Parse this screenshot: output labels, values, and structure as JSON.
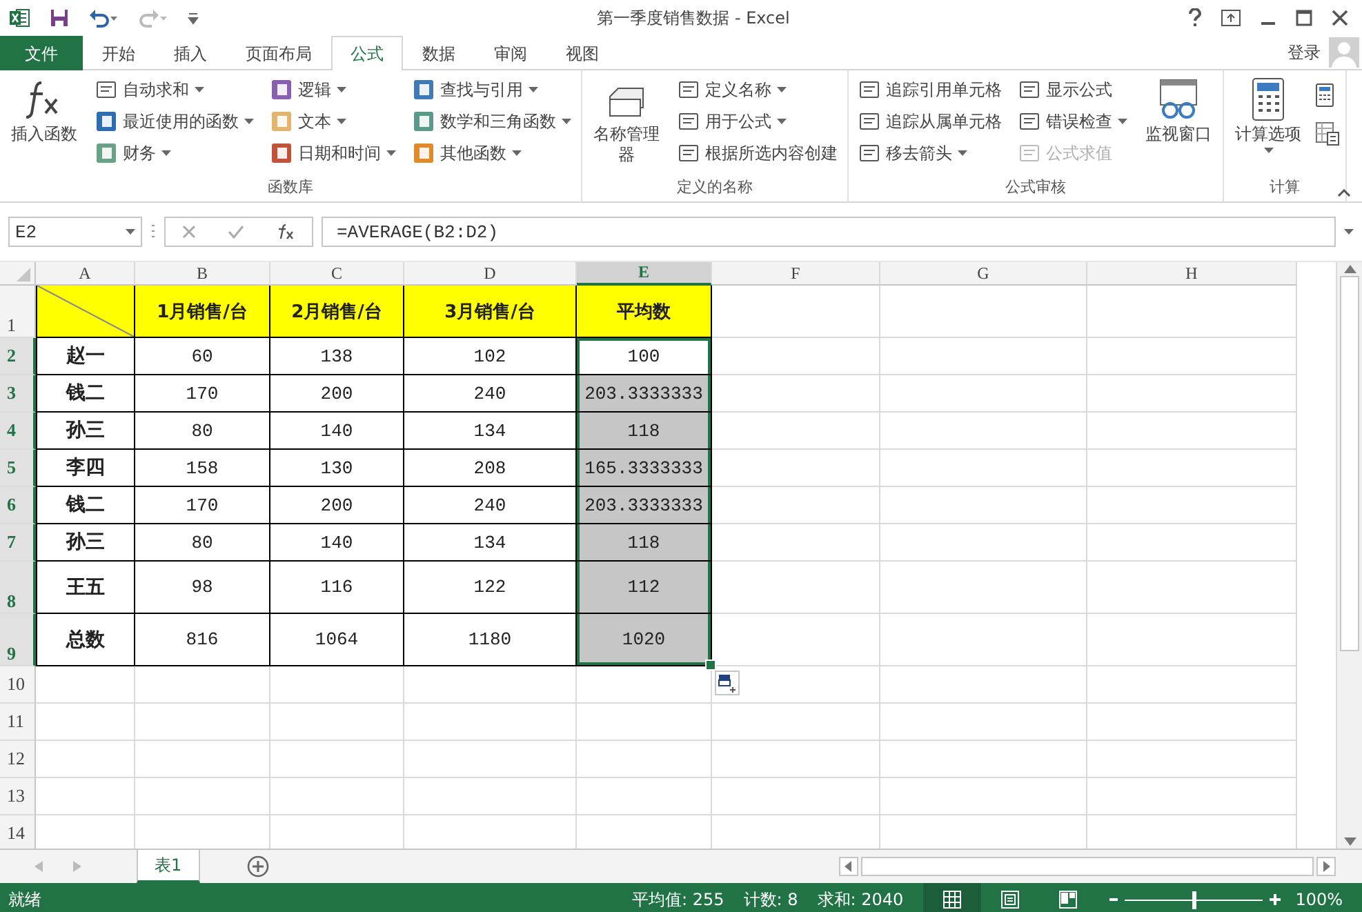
{
  "window": {
    "title": "第一季度销售数据 - Excel"
  },
  "account": {
    "label": "登录"
  },
  "tabs": [
    {
      "label": "文件",
      "kind": "file",
      "selected": false
    },
    {
      "label": "开始",
      "kind": "tab",
      "selected": false
    },
    {
      "label": "插入",
      "kind": "tab",
      "selected": false
    },
    {
      "label": "页面布局",
      "kind": "tab",
      "selected": false
    },
    {
      "label": "公式",
      "kind": "tab",
      "selected": true
    },
    {
      "label": "数据",
      "kind": "tab",
      "selected": false
    },
    {
      "label": "审阅",
      "kind": "tab",
      "selected": false
    },
    {
      "label": "视图",
      "kind": "tab",
      "selected": false
    }
  ],
  "ribbon": {
    "groups": [
      {
        "name": "函数库",
        "items": [
          {
            "kind": "large",
            "label": "插入函数",
            "dropdown": false
          },
          {
            "kind": "stack",
            "items": [
              {
                "label": "自动求和",
                "dropdown": true,
                "disabled": false
              },
              {
                "label": "最近使用的函数",
                "dropdown": true,
                "disabled": false,
                "color": "#2f6db3"
              },
              {
                "label": "财务",
                "dropdown": true,
                "disabled": false,
                "color": "#6aa287"
              }
            ]
          },
          {
            "kind": "stack",
            "items": [
              {
                "label": "逻辑",
                "dropdown": true,
                "disabled": false,
                "color": "#8a5fb0"
              },
              {
                "label": "文本",
                "dropdown": true,
                "disabled": false,
                "color": "#e3b46e"
              },
              {
                "label": "日期和时间",
                "dropdown": true,
                "disabled": false,
                "color": "#c0533a"
              }
            ]
          },
          {
            "kind": "stack",
            "items": [
              {
                "label": "查找与引用",
                "dropdown": true,
                "disabled": false,
                "color": "#3f7bb5"
              },
              {
                "label": "数学和三角函数",
                "dropdown": true,
                "disabled": false,
                "color": "#5b9a8b"
              },
              {
                "label": "其他函数",
                "dropdown": true,
                "disabled": false,
                "color": "#e08a2a"
              }
            ]
          }
        ]
      },
      {
        "name": "定义的名称",
        "items": [
          {
            "kind": "large",
            "label": "名称管理器",
            "dropdown": false
          },
          {
            "kind": "stack",
            "items": [
              {
                "label": "定义名称",
                "dropdown": true,
                "disabled": false
              },
              {
                "label": "用于公式",
                "dropdown": true,
                "disabled": false
              },
              {
                "label": "根据所选内容创建",
                "dropdown": false,
                "disabled": false
              }
            ]
          }
        ]
      },
      {
        "name": "公式审核",
        "items": [
          {
            "kind": "stack",
            "items": [
              {
                "label": "追踪引用单元格",
                "dropdown": false,
                "disabled": false
              },
              {
                "label": "追踪从属单元格",
                "dropdown": false,
                "disabled": false
              },
              {
                "label": "移去箭头",
                "dropdown": true,
                "disabled": false
              }
            ]
          },
          {
            "kind": "stack",
            "items": [
              {
                "label": "显示公式",
                "dropdown": false,
                "disabled": false
              },
              {
                "label": "错误检查",
                "dropdown": true,
                "disabled": false
              },
              {
                "label": "公式求值",
                "dropdown": false,
                "disabled": true
              }
            ]
          },
          {
            "kind": "large",
            "label": "监视窗口",
            "dropdown": false
          }
        ]
      },
      {
        "name": "计算",
        "items": [
          {
            "kind": "large",
            "label": "计算选项",
            "dropdown": true
          },
          {
            "kind": "icons"
          }
        ]
      }
    ]
  },
  "formula_bar": {
    "name_box": "E2",
    "formula": "=AVERAGE(B2:D2)"
  },
  "columns": [
    {
      "label": "A",
      "selected": false
    },
    {
      "label": "B",
      "selected": false
    },
    {
      "label": "C",
      "selected": false
    },
    {
      "label": "D",
      "selected": false
    },
    {
      "label": "E",
      "selected": true
    },
    {
      "label": "F",
      "selected": false
    },
    {
      "label": "G",
      "selected": false
    },
    {
      "label": "H",
      "selected": false
    }
  ],
  "rows": [
    {
      "number": "1",
      "kind": "header",
      "selected": false,
      "highlighted": false,
      "tall": true,
      "values": [
        "1月销售/台",
        "2月销售/台",
        "3月销售/台",
        "平均数"
      ]
    },
    {
      "number": "2",
      "kind": "data",
      "selected": true,
      "highlighted": false,
      "tall": false,
      "label": "赵一",
      "values": [
        "60",
        "138",
        "102",
        "100"
      ]
    },
    {
      "number": "3",
      "kind": "data",
      "selected": true,
      "highlighted": true,
      "tall": false,
      "label": "钱二",
      "values": [
        "170",
        "200",
        "240",
        "203.3333333"
      ]
    },
    {
      "number": "4",
      "kind": "data",
      "selected": true,
      "highlighted": true,
      "tall": false,
      "label": "孙三",
      "values": [
        "80",
        "140",
        "134",
        "118"
      ]
    },
    {
      "number": "5",
      "kind": "data",
      "selected": true,
      "highlighted": true,
      "tall": false,
      "label": "李四",
      "values": [
        "158",
        "130",
        "208",
        "165.3333333"
      ]
    },
    {
      "number": "6",
      "kind": "data",
      "selected": true,
      "highlighted": true,
      "tall": false,
      "label": "钱二",
      "values": [
        "170",
        "200",
        "240",
        "203.3333333"
      ]
    },
    {
      "number": "7",
      "kind": "data",
      "selected": true,
      "highlighted": true,
      "tall": false,
      "label": "孙三",
      "values": [
        "80",
        "140",
        "134",
        "118"
      ]
    },
    {
      "number": "8",
      "kind": "data",
      "selected": true,
      "highlighted": true,
      "tall": true,
      "label": "王五",
      "values": [
        "98",
        "116",
        "122",
        "112"
      ]
    },
    {
      "number": "9",
      "kind": "data",
      "selected": true,
      "highlighted": true,
      "tall": true,
      "label": "总数",
      "values": [
        "816",
        "1064",
        "1180",
        "1020"
      ]
    },
    {
      "number": "10",
      "kind": "empty",
      "selected": false,
      "highlighted": false,
      "tall": false
    },
    {
      "number": "11",
      "kind": "empty",
      "selected": false,
      "highlighted": false,
      "tall": false
    },
    {
      "number": "12",
      "kind": "empty",
      "selected": false,
      "highlighted": false,
      "tall": false
    },
    {
      "number": "13",
      "kind": "empty",
      "selected": false,
      "highlighted": false,
      "tall": false
    },
    {
      "number": "14",
      "kind": "empty",
      "selected": false,
      "highlighted": false,
      "tall": false
    }
  ],
  "sheet_tabs": [
    {
      "label": "表1",
      "selected": true
    }
  ],
  "status_bar": {
    "status": "就绪",
    "stats": [
      "平均值: 255",
      "计数: 8",
      "求和: 2040"
    ],
    "views": [
      {
        "kind": "normal",
        "selected": true
      },
      {
        "kind": "layout",
        "selected": false
      },
      {
        "kind": "pagebreak",
        "selected": false
      }
    ],
    "zoom": {
      "level": 0.5,
      "reading": "100%"
    }
  }
}
